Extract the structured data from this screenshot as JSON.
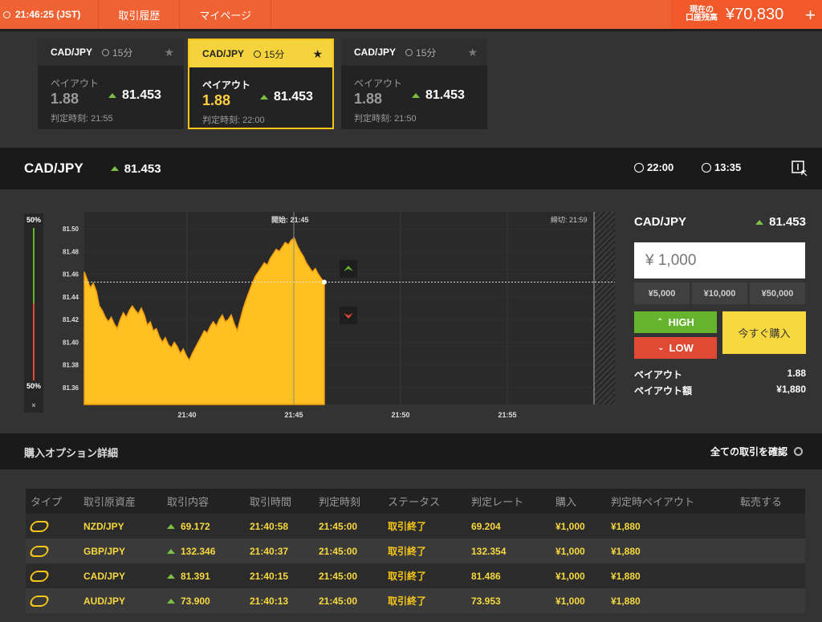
{
  "topbar": {
    "clock": "21:46:25 (JST)",
    "nav": [
      "取引履歴",
      "マイページ"
    ],
    "balance_label_1": "現在の",
    "balance_label_2": "口座残高",
    "balance_amount": "¥70,830",
    "plus": "+"
  },
  "cards": [
    {
      "pair": "CAD/JPY",
      "duration": "15分",
      "payout_label": "ペイアウト",
      "payout": "1.88",
      "rate": "81.453",
      "time": "判定時刻: 21:55"
    },
    {
      "pair": "CAD/JPY",
      "duration": "15分",
      "payout_label": "ペイアウト",
      "payout": "1.88",
      "rate": "81.453",
      "time": "判定時刻: 22:00"
    },
    {
      "pair": "CAD/JPY",
      "duration": "15分",
      "payout_label": "ペイアウト",
      "payout": "1.88",
      "rate": "81.453",
      "time": "判定時刻: 21:50"
    }
  ],
  "asset": {
    "name": "CAD/JPY",
    "rate": "81.453",
    "close_time": "22:00",
    "remaining": "13:35"
  },
  "chart_data": {
    "type": "area",
    "start_label": "開始: 21:45",
    "end_label": "締切: 21:59",
    "gauge_top": "50%",
    "gauge_bottom": "50%",
    "gauge_close": "×",
    "xticks": [
      "21:40",
      "21:45",
      "21:50",
      "21:55"
    ],
    "yticks": [
      "81.50",
      "81.48",
      "81.46",
      "81.44",
      "81.42",
      "81.40",
      "81.38",
      "81.36"
    ],
    "ylim": [
      81.345,
      81.515
    ],
    "current": 81.453,
    "series": [
      {
        "x": [
          0,
          1,
          2,
          3,
          4,
          5,
          6,
          7,
          8,
          9,
          10,
          11,
          12,
          13,
          14,
          15,
          16,
          17,
          18,
          19,
          20,
          21,
          22,
          23,
          24,
          25,
          26,
          27,
          28,
          29,
          30,
          31,
          32,
          33,
          34,
          35,
          36,
          37,
          38,
          39,
          40,
          41,
          42,
          43,
          44,
          45,
          46,
          47,
          48,
          49,
          50,
          51,
          52,
          53,
          54,
          55,
          56,
          57,
          58,
          59,
          60,
          61,
          62,
          63,
          64,
          65,
          66,
          67,
          68,
          69,
          70,
          71,
          72,
          73,
          74,
          75,
          76,
          77,
          78,
          79,
          80
        ],
        "values": [
          81.462,
          81.455,
          81.448,
          81.452,
          81.445,
          81.432,
          81.428,
          81.422,
          81.418,
          81.422,
          81.416,
          81.412,
          81.42,
          81.426,
          81.422,
          81.428,
          81.432,
          81.428,
          81.425,
          81.43,
          81.424,
          81.415,
          81.418,
          81.41,
          81.412,
          81.405,
          81.4,
          81.404,
          81.398,
          81.395,
          81.4,
          81.396,
          81.39,
          81.394,
          81.388,
          81.384,
          81.39,
          81.395,
          81.4,
          81.405,
          81.41,
          81.408,
          81.414,
          81.418,
          81.414,
          81.42,
          81.424,
          81.418,
          81.42,
          81.424,
          81.416,
          81.41,
          81.42,
          81.43,
          81.438,
          81.445,
          81.452,
          81.458,
          81.462,
          81.466,
          81.47,
          81.468,
          81.474,
          81.478,
          81.482,
          81.48,
          81.484,
          81.488,
          81.486,
          81.49,
          81.492,
          81.485,
          81.48,
          81.476,
          81.47,
          81.466,
          81.462,
          81.465,
          81.46,
          81.456,
          81.453
        ]
      }
    ]
  },
  "order": {
    "asset": "CAD/JPY",
    "rate": "81.453",
    "amount_placeholder": "¥ 1,000",
    "quick": [
      "¥5,000",
      "¥10,000",
      "¥50,000"
    ],
    "high": "HIGH",
    "low": "LOW",
    "buy_now": "今すぐ購入",
    "payout_label": "ペイアウト",
    "payout_value": "1.88",
    "payout_amount_label": "ペイアウト額",
    "payout_amount_value": "¥1,880"
  },
  "details": {
    "title": "購入オプション詳細",
    "view_all": "全ての取引を確認",
    "headers": [
      "タイプ",
      "取引原資産",
      "取引内容",
      "取引時間",
      "判定時刻",
      "ステータス",
      "判定レート",
      "購入",
      "判定時ペイアウト",
      "転売する"
    ],
    "rows": [
      {
        "asset": "NZD/JPY",
        "content": "69.172",
        "trade_time": "21:40:58",
        "judge_time": "21:45:00",
        "status": "取引終了",
        "judge_rate": "69.204",
        "purchase": "¥1,000",
        "payout": "¥1,880"
      },
      {
        "asset": "GBP/JPY",
        "content": "132.346",
        "trade_time": "21:40:37",
        "judge_time": "21:45:00",
        "status": "取引終了",
        "judge_rate": "132.354",
        "purchase": "¥1,000",
        "payout": "¥1,880"
      },
      {
        "asset": "CAD/JPY",
        "content": "81.391",
        "trade_time": "21:40:15",
        "judge_time": "21:45:00",
        "status": "取引終了",
        "judge_rate": "81.486",
        "purchase": "¥1,000",
        "payout": "¥1,880"
      },
      {
        "asset": "AUD/JPY",
        "content": "73.900",
        "trade_time": "21:40:13",
        "judge_time": "21:45:00",
        "status": "取引終了",
        "judge_rate": "73.953",
        "purchase": "¥1,000",
        "payout": "¥1,880"
      }
    ]
  }
}
